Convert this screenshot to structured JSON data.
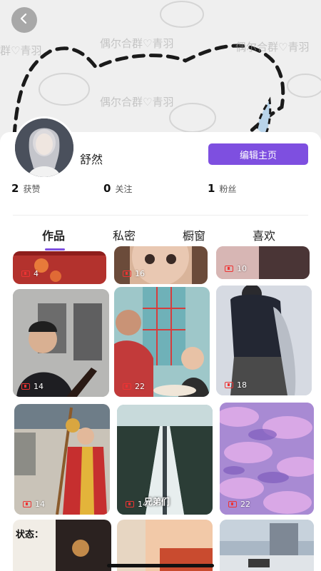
{
  "cover": {
    "watermarks": [
      "偶尔合群♡青羽",
      "偶尔合群♡青羽",
      "偶尔合群♡青羽",
      "群♡青羽"
    ]
  },
  "profile": {
    "username": "舒然",
    "edit_button": "编辑主页",
    "stats": [
      {
        "num": "2",
        "label": "获赞"
      },
      {
        "num": "0",
        "label": "关注"
      },
      {
        "num": "1",
        "label": "粉丝"
      }
    ]
  },
  "tabs": [
    {
      "label": "作品",
      "active": true
    },
    {
      "label": "私密",
      "active": false
    },
    {
      "label": "橱窗",
      "active": false
    },
    {
      "label": "喜欢",
      "active": false
    }
  ],
  "videos": [
    {
      "count": "4"
    },
    {
      "count": "16"
    },
    {
      "count": "10"
    },
    {
      "count": "14"
    },
    {
      "count": "22"
    },
    {
      "count": "18"
    },
    {
      "count": "14"
    },
    {
      "count": "14",
      "caption": "兄弟们"
    },
    {
      "count": "22"
    }
  ],
  "status_label": "状态：",
  "colors": {
    "accent": "#7e4fe0",
    "counter_icon": "#e33333"
  },
  "icons": {
    "back": "chevron-left-icon",
    "counter": "play-count-icon"
  }
}
